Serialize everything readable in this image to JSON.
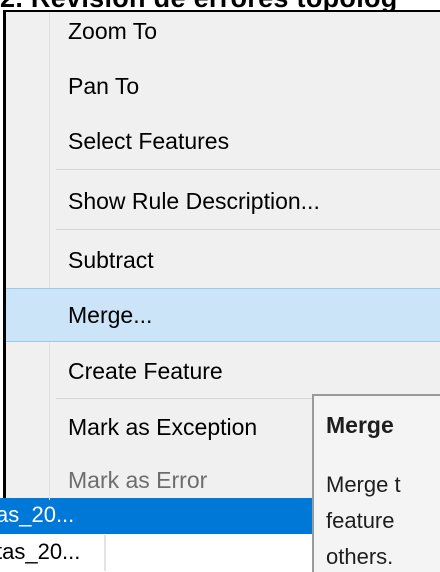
{
  "heading": "2. Revisión de errores topológ",
  "menu": {
    "items": [
      {
        "label": "Zoom To"
      },
      {
        "label": "Pan To"
      },
      {
        "label": "Select Features"
      },
      {
        "label": "Show Rule Description..."
      },
      {
        "label": "Subtract"
      },
      {
        "label": "Merge..."
      },
      {
        "label": "Create Feature"
      },
      {
        "label": "Mark as Exception"
      },
      {
        "label": "Mark as Error"
      }
    ],
    "highlighted_item": "Merge...",
    "disabled_item": "Mark as Error"
  },
  "tooltip": {
    "title": "Merge",
    "lines": [
      "Merge t",
      "feature",
      "others."
    ]
  },
  "background_table": {
    "rows": [
      {
        "cell": "as_20..."
      },
      {
        "cell": "tas_20..."
      }
    ]
  },
  "colors": {
    "menu_bg": "#f0f0f0",
    "highlight_bg": "#cce4f7",
    "highlight_border": "#99c9ef",
    "selection_blue": "#0078d7",
    "disabled_text": "#6d6d6d"
  }
}
